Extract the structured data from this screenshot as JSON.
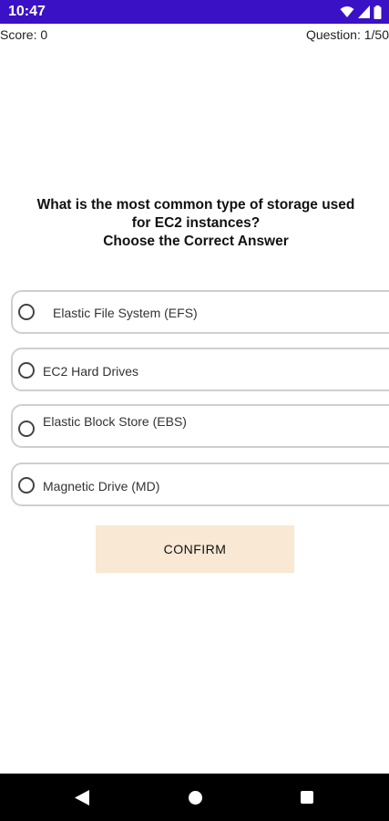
{
  "status_bar": {
    "time": "10:47",
    "icons": [
      "wifi-icon",
      "signal-icon",
      "battery-icon"
    ],
    "background": "#3b11c6"
  },
  "header": {
    "score": "Score: 0",
    "question_count": "Question: 1/50"
  },
  "question": {
    "lines": [
      "What is the most common type of storage used",
      "for EC2 instances?",
      "Choose the Correct Answer"
    ]
  },
  "options": [
    {
      "label": "Elastic File System (EFS)",
      "selected": false
    },
    {
      "label": "EC2 Hard Drives",
      "selected": false
    },
    {
      "label": "Elastic Block Store (EBS)",
      "selected": false
    },
    {
      "label": "Magnetic Drive (MD)",
      "selected": false
    }
  ],
  "confirm": {
    "label": "CONFIRM",
    "background": "#f8e8d4"
  },
  "nav_bar": {
    "icons": [
      "back-icon",
      "home-icon",
      "recents-icon"
    ]
  }
}
